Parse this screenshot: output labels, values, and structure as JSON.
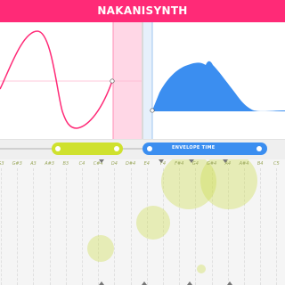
{
  "header": {
    "title": "NAKANISYNTH",
    "accent": "#ff2a77"
  },
  "wave_panel": {
    "line_color": "#ff2a77",
    "highlight_color": "#ffd7e6"
  },
  "envelope_panel": {
    "fill_color": "#3b8ef0"
  },
  "sliders": {
    "wave": {
      "color": "#cfe12e"
    },
    "envelope": {
      "label": "ENVELOPE TIME",
      "color": "#3b8ef0"
    }
  },
  "keyboard": {
    "notes": [
      "G3",
      "G#3",
      "A3",
      "A#3",
      "B3",
      "C4",
      "C#4",
      "D4",
      "D#4",
      "E4",
      "F4",
      "F#4",
      "G4",
      "G#4",
      "A4",
      "A#4",
      "B4",
      "C5"
    ],
    "active_note_color": "#cdda50"
  }
}
